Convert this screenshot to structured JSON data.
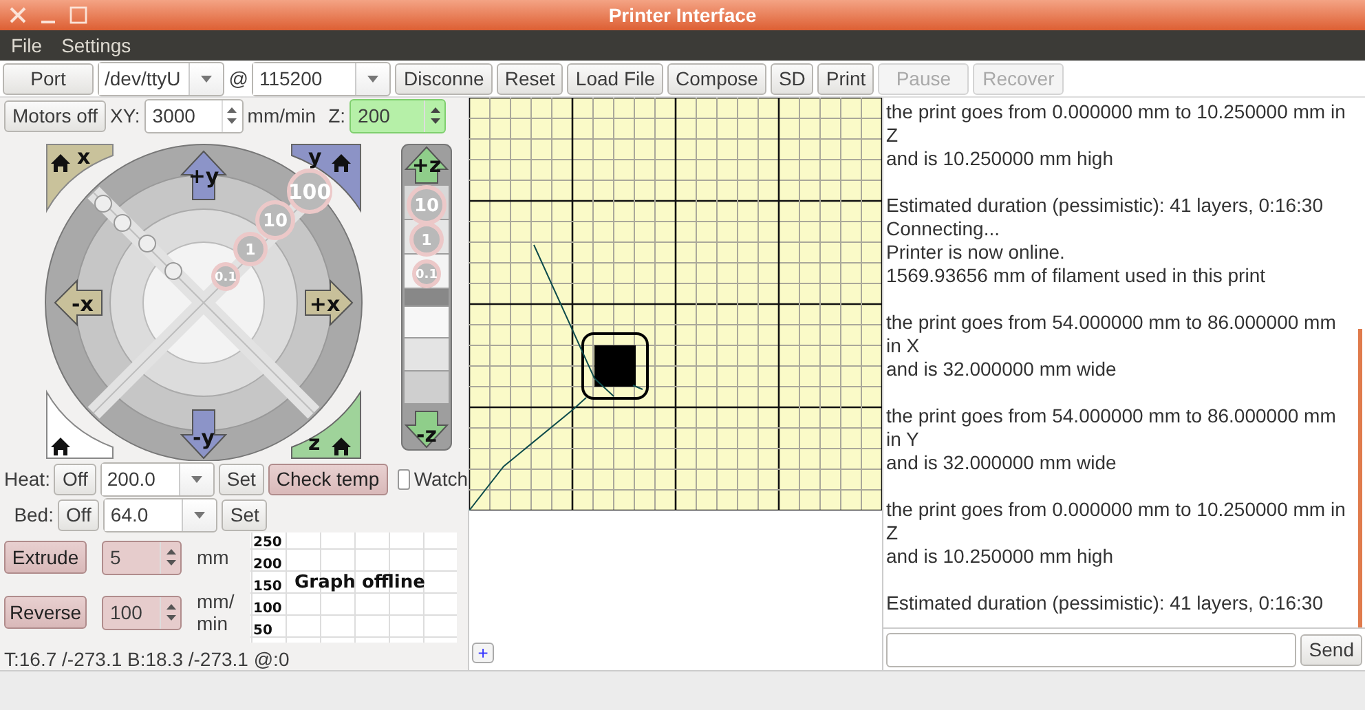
{
  "window": {
    "title": "Printer Interface"
  },
  "menu": [
    "File",
    "Settings"
  ],
  "toolbar": {
    "port_button": "Port",
    "port": "/dev/ttyU",
    "at": "@",
    "baud": "115200",
    "buttons": [
      {
        "label": "Disconne",
        "disabled": false
      },
      {
        "label": "Reset",
        "disabled": false
      },
      {
        "label": "Load File",
        "disabled": false
      },
      {
        "label": "Compose",
        "disabled": false
      },
      {
        "label": "SD",
        "disabled": false
      },
      {
        "label": "Print",
        "disabled": false
      },
      {
        "label": "Pause",
        "disabled": true
      },
      {
        "label": "Recover",
        "disabled": true
      }
    ]
  },
  "motion": {
    "motors_button": "Motors off",
    "xy_label": "XY:",
    "xy_feed": "3000",
    "feed_unit": "mm/min",
    "z_label": "Z:",
    "z_feed": "200"
  },
  "xy_jog": {
    "home_x": "x",
    "home_y": "y",
    "home_z": "z",
    "plus_y": "+y",
    "minus_y": "-y",
    "minus_x": "-x",
    "plus_x": "+x",
    "steps": [
      "100",
      "10",
      "1",
      "0.1"
    ]
  },
  "z_jog": {
    "plus": "+z",
    "minus": "-z",
    "steps": [
      "10",
      "1",
      "0.1"
    ]
  },
  "heat": {
    "label": "Heat:",
    "off": "Off",
    "value": "200.0",
    "set": "Set"
  },
  "check_temp": "Check temp",
  "watch": {
    "label": "Watch",
    "checked": false
  },
  "bed": {
    "label": "Bed:",
    "off": "Off",
    "value": "64.0",
    "set": "Set"
  },
  "extrude": {
    "button": "Extrude",
    "amount": "5",
    "unit": "mm"
  },
  "reverse": {
    "button": "Reverse",
    "feed": "100",
    "unit": "mm/ min"
  },
  "graph": {
    "yticks": [
      "250",
      "200",
      "150",
      "100",
      "50"
    ],
    "message": "Graph offline"
  },
  "temperature_status": "T:16.7 /-273.1 B:18.3 /-273.1 @:0",
  "canvas": {
    "zoom_button": "+"
  },
  "log": {
    "blocks": [
      [
        "the print goes from 0.000000 mm to 10.250000 mm in Z",
        "and is 10.250000 mm high"
      ],
      [
        "Estimated duration (pessimistic):  41 layers, 0:16:30",
        "Connecting...",
        "Printer is now online.",
        "1569.93656 mm of filament used in this print"
      ],
      [
        "the print goes from 54.000000 mm to 86.000000 mm in X",
        "and is 32.000000 mm wide"
      ],
      [
        "the print goes from 54.000000 mm to 86.000000 mm in Y",
        "and is 32.000000 mm wide"
      ],
      [
        "the print goes from 0.000000 mm to 10.250000 mm in Z",
        "and is 10.250000 mm high"
      ],
      [
        "Estimated duration (pessimistic):  41 layers, 0:16:30"
      ]
    ]
  },
  "command": {
    "send": "Send"
  }
}
